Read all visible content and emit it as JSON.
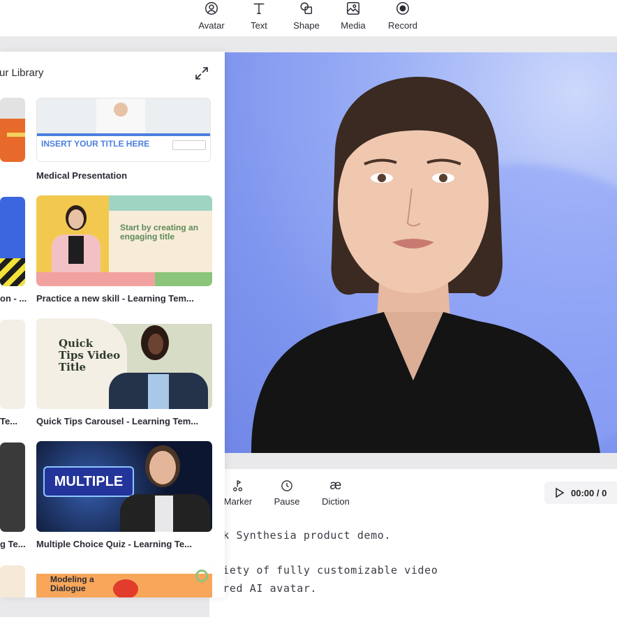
{
  "toolbar": {
    "items": [
      {
        "label": "Avatar",
        "icon": "avatar-icon"
      },
      {
        "label": "Text",
        "icon": "text-icon"
      },
      {
        "label": "Shape",
        "icon": "shape-icon"
      },
      {
        "label": "Media",
        "icon": "media-icon"
      },
      {
        "label": "Record",
        "icon": "record-icon"
      }
    ]
  },
  "library": {
    "title": "ur Library",
    "expand_icon": "expand-icon",
    "left_column_labels": [
      "on - ...",
      "Te...",
      "g Te..."
    ],
    "cards": [
      {
        "label": "Medical Presentation",
        "thumb_text": "INSERT YOUR TITLE HERE"
      },
      {
        "label": "Practice a new skill - Learning Tem...",
        "thumb_text": "Start by creating an engaging title"
      },
      {
        "label": "Quick Tips Carousel - Learning Tem...",
        "thumb_text": "Quick Tips Video Title"
      },
      {
        "label": "Multiple Choice Quiz - Learning Te...",
        "thumb_text": "MULTIPLE"
      },
      {
        "label": "",
        "thumb_text": "Modeling a Dialogue"
      }
    ]
  },
  "editor": {
    "tools": [
      {
        "label": "Marker",
        "icon": "marker-icon"
      },
      {
        "label": "Pause",
        "icon": "clock-icon"
      },
      {
        "label": "Diction",
        "icon": "diction-icon"
      }
    ],
    "diction_glyph": "æ",
    "time": "00:00 / 0",
    "play_icon": "play-icon",
    "script_lines": [
      "ick Synthesia product demo.",
      "ariety of fully customizable video",
      "erred AI avatar."
    ]
  },
  "colors": {
    "canvas_blue": "#8aa0f2",
    "panel_bg": "#ffffff",
    "workspace_bg": "#e9e9ec"
  }
}
